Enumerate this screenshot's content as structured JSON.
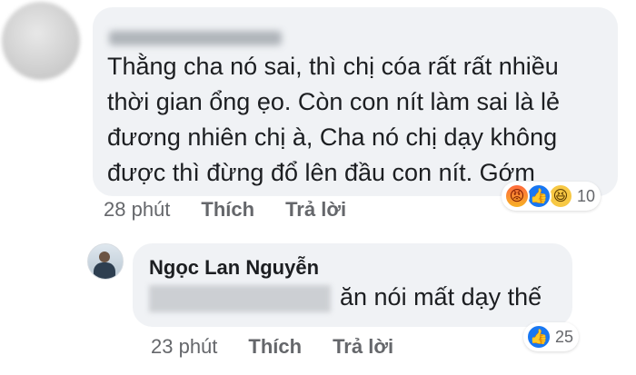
{
  "comment1": {
    "text": "Thằng cha nó sai, thì chị cóa rất rất nhiều thời gian ổng ẹo. Còn con nít làm sai là lẻ đương nhiên chị à, Cha nó chị dạy không được thì đừng đổ lên đầu con nít. Gớm",
    "time": "28 phút",
    "like_label": "Thích",
    "reply_label": "Trả lời",
    "reactions": [
      "angry-icon",
      "like-icon",
      "haha-icon"
    ],
    "reaction_count": "10"
  },
  "comment2": {
    "author": "Ngọc Lan Nguyễn",
    "text": "ăn nói mất dạy thế",
    "time": "23 phút",
    "like_label": "Thích",
    "reply_label": "Trả lời",
    "reactions": [
      "like-icon"
    ],
    "reaction_count": "25"
  },
  "colors": {
    "bubble": "#f0f2f5",
    "text": "#1c1e21",
    "meta": "#65676b",
    "like": "#1877f2"
  }
}
